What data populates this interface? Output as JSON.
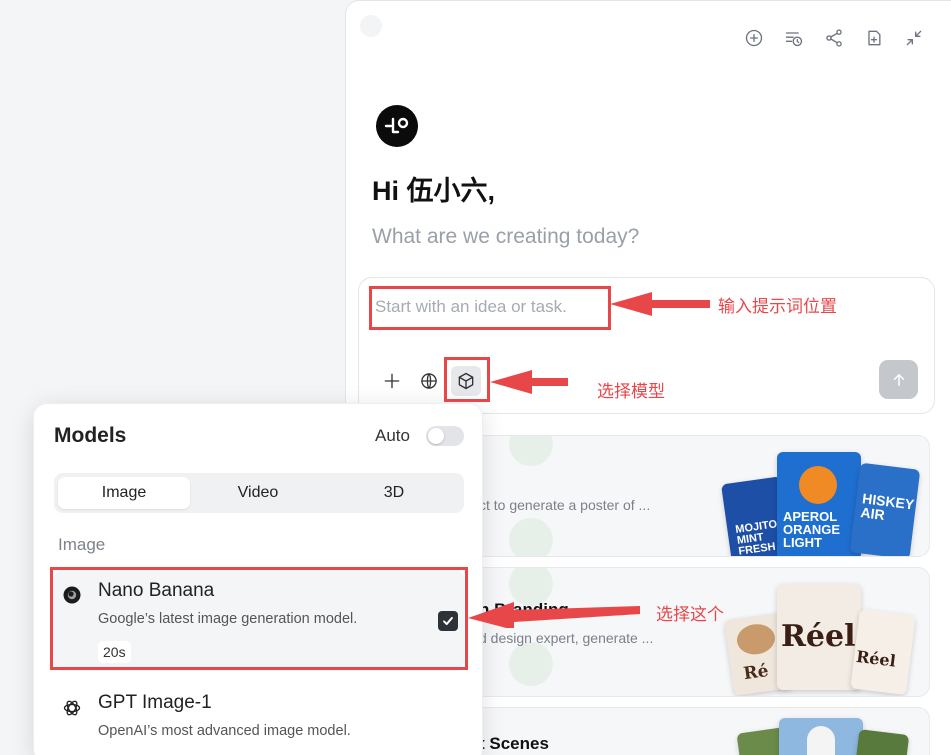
{
  "header": {
    "icons": [
      "new-chat-icon",
      "history-icon",
      "share-icon",
      "files-icon",
      "collapse-icon"
    ]
  },
  "greeting": "Hi 伍小六,",
  "subtitle": "What are we creating today?",
  "prompt_input": {
    "placeholder": "Start with an idea or task."
  },
  "toolbar": {
    "icons": [
      "plus-icon",
      "globe-icon",
      "model-cube-icon",
      "send-arrow-icon"
    ]
  },
  "cards": [
    {
      "title": "",
      "desc": "ct to generate a poster of ...",
      "thumbs": [
        "MOJITO MINT FRESH",
        "APEROL ORANGE LIGHT",
        "HISKEY AIR"
      ]
    },
    {
      "title": "n Branding",
      "desc": "d design expert, generate ...",
      "thumbs": [
        "Ré",
        "Réel",
        "Réel"
      ]
    },
    {
      "title": "t Scenes",
      "desc": ""
    }
  ],
  "models_popup": {
    "title": "Models",
    "auto_label": "Auto",
    "auto_enabled": false,
    "tabs": [
      "Image",
      "Video",
      "3D"
    ],
    "active_tab": "Image",
    "section": "Image",
    "items": [
      {
        "name": "Nano Banana",
        "desc": "Google’s latest image generation model.",
        "badge": "20s",
        "selected": true
      },
      {
        "name": "GPT Image-1",
        "desc": "OpenAI’s most advanced image model.",
        "selected": false
      }
    ]
  },
  "annotations": {
    "prompt_note": "输入提示词位置",
    "model_note": "选择模型",
    "choose_note": "选择这个",
    "color": "#e8474a"
  }
}
